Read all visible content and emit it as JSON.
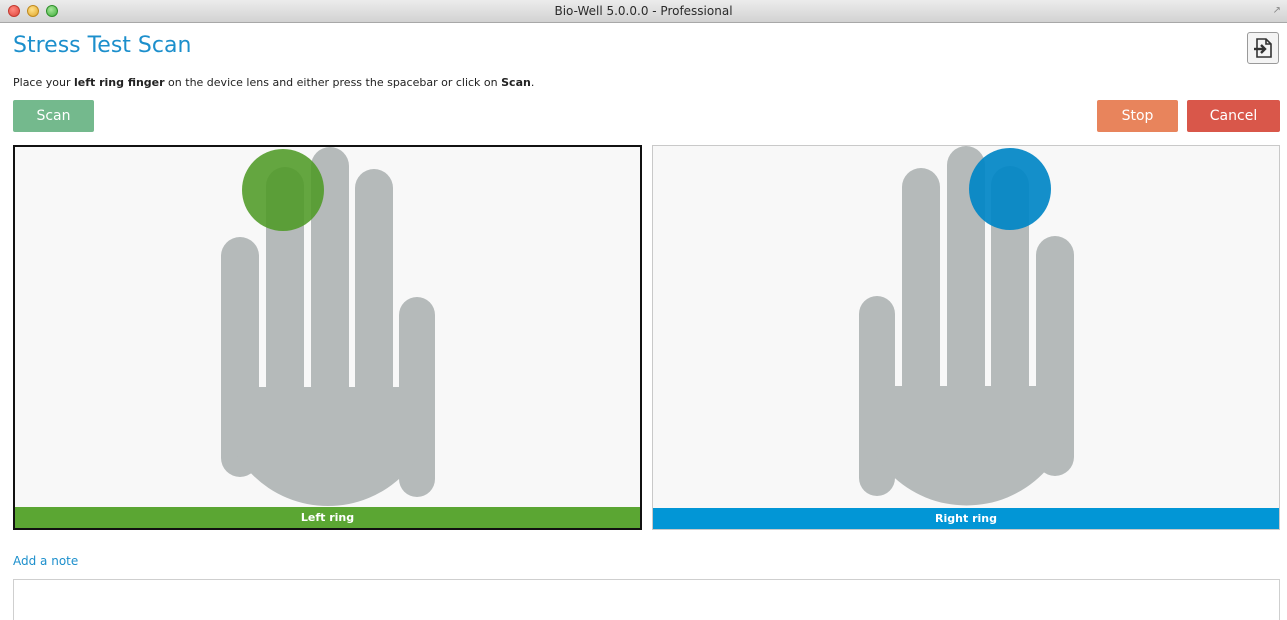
{
  "window": {
    "title": "Bio-Well 5.0.0.0 - Professional",
    "fullscreen_icon": "fullscreen-arrows-icon"
  },
  "header": {
    "title": "Stress Test Scan",
    "export_icon": "export-arrow-icon"
  },
  "instruction": {
    "prefix": "Place your ",
    "finger": "left ring finger",
    "middle": " on the device lens and either press the spacebar or click on ",
    "action": "Scan",
    "suffix": "."
  },
  "buttons": {
    "scan": "Scan",
    "stop": "Stop",
    "cancel": "Cancel"
  },
  "panels": {
    "left": {
      "label": "Left ring",
      "hand": "left",
      "highlight_color": "#5ba633",
      "selected": true
    },
    "right": {
      "label": "Right ring",
      "hand": "right",
      "highlight_color": "#0296d6",
      "selected": false
    }
  },
  "note": {
    "label": "Add a note",
    "value": ""
  },
  "colors": {
    "accent": "#1c8fcc",
    "scan": "#74b98d",
    "stop": "#e8845c",
    "cancel": "#d9574a",
    "hand": "#b5baba"
  }
}
